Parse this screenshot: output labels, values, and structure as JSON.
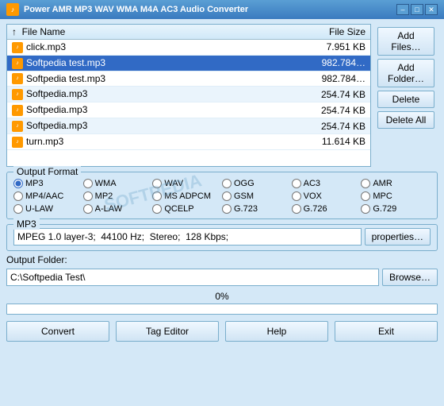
{
  "window": {
    "title": "Power AMR MP3 WAV WMA M4A AC3 Audio Converter",
    "controls": {
      "minimize": "–",
      "maximize": "□",
      "close": "✕"
    }
  },
  "file_table": {
    "columns": [
      {
        "label": "↑  File Name",
        "key": "name"
      },
      {
        "label": "File Size",
        "key": "size"
      }
    ],
    "rows": [
      {
        "name": "click.mp3",
        "size": "7.951 KB",
        "selected": false
      },
      {
        "name": "Softpedia test.mp3",
        "size": "982.784…",
        "selected": true
      },
      {
        "name": "Softpedia test.mp3",
        "size": "982.784…",
        "selected": false
      },
      {
        "name": "Softpedia.mp3",
        "size": "254.74 KB",
        "selected": false
      },
      {
        "name": "Softpedia.mp3",
        "size": "254.74 KB",
        "selected": false
      },
      {
        "name": "Softpedia.mp3",
        "size": "254.74 KB",
        "selected": false
      },
      {
        "name": "turn.mp3",
        "size": "11.614 KB",
        "selected": false
      }
    ]
  },
  "side_buttons": {
    "add_files": "Add Files…",
    "add_folder": "Add Folder…",
    "delete": "Delete",
    "delete_all": "Delete All"
  },
  "output_format": {
    "label": "Output Format",
    "options": [
      {
        "id": "mp3",
        "label": "MP3",
        "checked": true
      },
      {
        "id": "wma",
        "label": "WMA",
        "checked": false
      },
      {
        "id": "wav",
        "label": "WAV",
        "checked": false
      },
      {
        "id": "ogg",
        "label": "OGG",
        "checked": false
      },
      {
        "id": "ac3",
        "label": "AC3",
        "checked": false
      },
      {
        "id": "amr",
        "label": "AMR",
        "checked": false
      },
      {
        "id": "mp4aac",
        "label": "MP4/AAC",
        "checked": false
      },
      {
        "id": "mp2",
        "label": "MP2",
        "checked": false
      },
      {
        "id": "ms_adpcm",
        "label": "MS ADPCM",
        "checked": false
      },
      {
        "id": "gsm",
        "label": "GSM",
        "checked": false
      },
      {
        "id": "vox",
        "label": "VOX",
        "checked": false
      },
      {
        "id": "mpc",
        "label": "MPC",
        "checked": false
      },
      {
        "id": "u_law",
        "label": "U-LAW",
        "checked": false
      },
      {
        "id": "a_law",
        "label": "A-LAW",
        "checked": false
      },
      {
        "id": "qcelp",
        "label": "QCELP",
        "checked": false
      },
      {
        "id": "g723",
        "label": "G.723",
        "checked": false
      },
      {
        "id": "g726",
        "label": "G.726",
        "checked": false
      },
      {
        "id": "g729",
        "label": "G.729",
        "checked": false
      }
    ]
  },
  "mp3_section": {
    "label": "MP3",
    "description": "MPEG 1.0 layer-3;  44100 Hz;  Stereo;  128 Kbps;",
    "properties_btn": "properties…"
  },
  "output_folder": {
    "label": "Output Folder:",
    "path": "C:\\Softpedia Test\\",
    "browse_btn": "Browse…"
  },
  "progress": {
    "label": "0%",
    "value": 0
  },
  "bottom_buttons": {
    "convert": "Convert",
    "tag_editor": "Tag Editor",
    "help": "Help",
    "exit": "Exit"
  },
  "watermark": "SOFTPEDIA"
}
